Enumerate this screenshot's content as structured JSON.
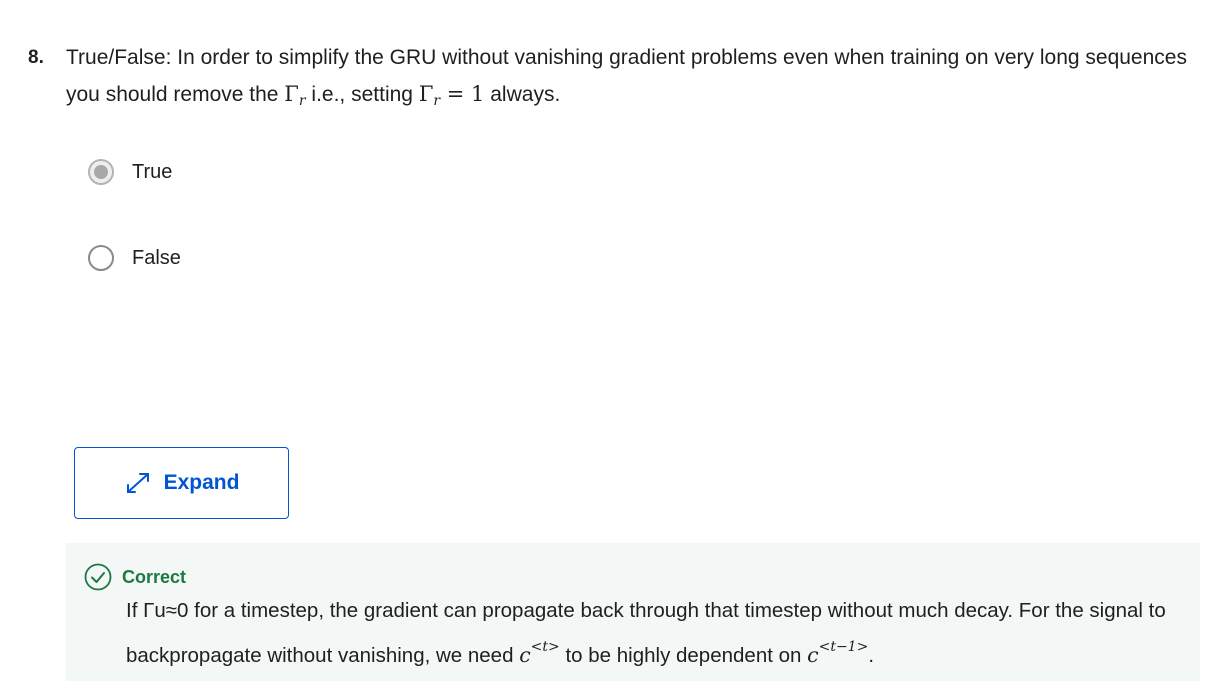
{
  "question": {
    "number": "8.",
    "text_a": "True/False: In order to simplify the GRU without vanishing gradient problems even when training on very long sequences you should remove the ",
    "gamma": "Γ",
    "gamma_sub": "r",
    "text_b": " i.e., setting ",
    "math_eq": " = ",
    "math_one": "1",
    "text_c": " always."
  },
  "options": [
    {
      "label": "True",
      "selected": true
    },
    {
      "label": "False",
      "selected": false
    }
  ],
  "expand_button": {
    "label": "Expand",
    "icon": "expand-arrows-icon"
  },
  "feedback": {
    "status": "Correct",
    "text_a": "If Γu≈0 for a timestep, the gradient can propagate back through that timestep without much decay. For the signal to backpropagate without vanishing, we need ",
    "c1": "c",
    "c1_sup": "<t>",
    "text_b": " to be highly dependent on ",
    "c2": "c",
    "c2_sup": "<t−1>",
    "text_c": ".",
    "icon": "check-circle-icon",
    "color": "#1c7844"
  },
  "colors": {
    "accent": "#0056d2",
    "feedback_bg": "#f3f7f5"
  }
}
